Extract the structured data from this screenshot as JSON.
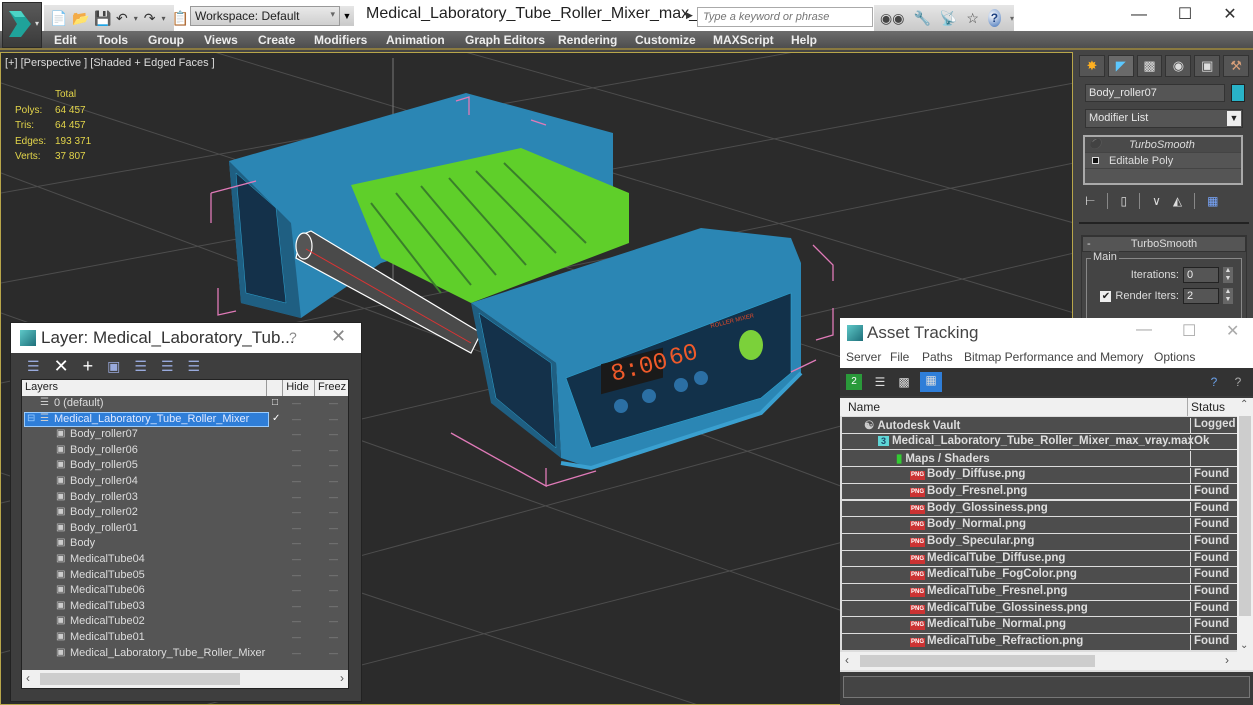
{
  "titlebar": {
    "workspace": "Workspace: Default",
    "document_title": "Medical_Laboratory_Tube_Roller_Mixer_max_...",
    "search_placeholder": "Type a keyword or phrase",
    "window_controls": {
      "minimize": "—",
      "maximize": "☐",
      "close": "✕"
    }
  },
  "menubar": {
    "items": [
      "Edit",
      "Tools",
      "Group",
      "Views",
      "Create",
      "Modifiers",
      "Animation",
      "Graph Editors",
      "Rendering",
      "Customize",
      "MAXScript",
      "Help"
    ]
  },
  "viewport": {
    "label": "[+] [Perspective ] [Shaded + Edged Faces ]",
    "stats": {
      "header": "Total",
      "rows": [
        {
          "key": "Polys:",
          "value": "64 457"
        },
        {
          "key": "Tris:",
          "value": "64 457"
        },
        {
          "key": "Edges:",
          "value": "193 371"
        },
        {
          "key": "Verts:",
          "value": "37 807"
        }
      ]
    },
    "model": {
      "display_time": "8:00",
      "display_speed": "60",
      "brand_text": "ROLLER MIXER"
    },
    "colors": {
      "body": "#2b86b4",
      "tubes": "#5fcf2a",
      "selection": "#e07ab8",
      "grid": "#5a5a5a"
    }
  },
  "command_panel": {
    "tabs": [
      "create-icon",
      "modify-icon",
      "hierarchy-icon",
      "motion-icon",
      "display-icon",
      "utilities-icon"
    ],
    "object_name": "Body_roller07",
    "object_color": "#29b3c8",
    "modifier_list_label": "Modifier List",
    "modifier_stack": [
      "TurboSmooth",
      "Editable Poly"
    ],
    "rollout": {
      "title": "TurboSmooth",
      "group": "Main",
      "iterations_label": "Iterations:",
      "iterations_value": "0",
      "render_iters_label": "Render Iters:",
      "render_iters_value": "2",
      "render_iters_checked": true
    }
  },
  "layer_dialog": {
    "title": "Layer: Medical_Laboratory_Tub...",
    "help": "?",
    "close": "✕",
    "columns": [
      "Layers",
      "",
      "Hide",
      "Freez"
    ],
    "rows": [
      {
        "name": "0 (default)",
        "level": 0,
        "type": "layer"
      },
      {
        "name": "Medical_Laboratory_Tube_Roller_Mixer",
        "level": 0,
        "type": "layer",
        "selected": true,
        "current": true
      },
      {
        "name": "Body_roller07",
        "level": 1,
        "type": "object"
      },
      {
        "name": "Body_roller06",
        "level": 1,
        "type": "object"
      },
      {
        "name": "Body_roller05",
        "level": 1,
        "type": "object"
      },
      {
        "name": "Body_roller04",
        "level": 1,
        "type": "object"
      },
      {
        "name": "Body_roller03",
        "level": 1,
        "type": "object"
      },
      {
        "name": "Body_roller02",
        "level": 1,
        "type": "object"
      },
      {
        "name": "Body_roller01",
        "level": 1,
        "type": "object"
      },
      {
        "name": "Body",
        "level": 1,
        "type": "object"
      },
      {
        "name": "MedicalTube04",
        "level": 1,
        "type": "object"
      },
      {
        "name": "MedicalTube05",
        "level": 1,
        "type": "object"
      },
      {
        "name": "MedicalTube06",
        "level": 1,
        "type": "object"
      },
      {
        "name": "MedicalTube03",
        "level": 1,
        "type": "object"
      },
      {
        "name": "MedicalTube02",
        "level": 1,
        "type": "object"
      },
      {
        "name": "MedicalTube01",
        "level": 1,
        "type": "object"
      },
      {
        "name": "Medical_Laboratory_Tube_Roller_Mixer",
        "level": 1,
        "type": "object"
      }
    ]
  },
  "asset_tracking": {
    "title": "Asset Tracking",
    "menu": [
      "Server",
      "File",
      "Paths",
      "Bitmap Performance and Memory",
      "Options"
    ],
    "columns": [
      "Name",
      "Status"
    ],
    "rows": [
      {
        "name": "Autodesk Vault",
        "status": "Logged Out",
        "level": 0,
        "icon": "vault"
      },
      {
        "name": "Medical_Laboratory_Tube_Roller_Mixer_max_vray.max",
        "status": "Ok",
        "level": 1,
        "icon": "max"
      },
      {
        "name": "Maps / Shaders",
        "status": "",
        "level": 2,
        "icon": "maps"
      },
      {
        "name": "Body_Diffuse.png",
        "status": "Found",
        "level": 3,
        "icon": "png"
      },
      {
        "name": "Body_Fresnel.png",
        "status": "Found",
        "level": 3,
        "icon": "png"
      },
      {
        "name": "Body_Glossiness.png",
        "status": "Found",
        "level": 3,
        "icon": "png"
      },
      {
        "name": "Body_Normal.png",
        "status": "Found",
        "level": 3,
        "icon": "png"
      },
      {
        "name": "Body_Specular.png",
        "status": "Found",
        "level": 3,
        "icon": "png"
      },
      {
        "name": "MedicalTube_Diffuse.png",
        "status": "Found",
        "level": 3,
        "icon": "png"
      },
      {
        "name": "MedicalTube_FogColor.png",
        "status": "Found",
        "level": 3,
        "icon": "png"
      },
      {
        "name": "MedicalTube_Fresnel.png",
        "status": "Found",
        "level": 3,
        "icon": "png"
      },
      {
        "name": "MedicalTube_Glossiness.png",
        "status": "Found",
        "level": 3,
        "icon": "png"
      },
      {
        "name": "MedicalTube_Normal.png",
        "status": "Found",
        "level": 3,
        "icon": "png"
      },
      {
        "name": "MedicalTube_Refraction.png",
        "status": "Found",
        "level": 3,
        "icon": "png"
      }
    ]
  }
}
